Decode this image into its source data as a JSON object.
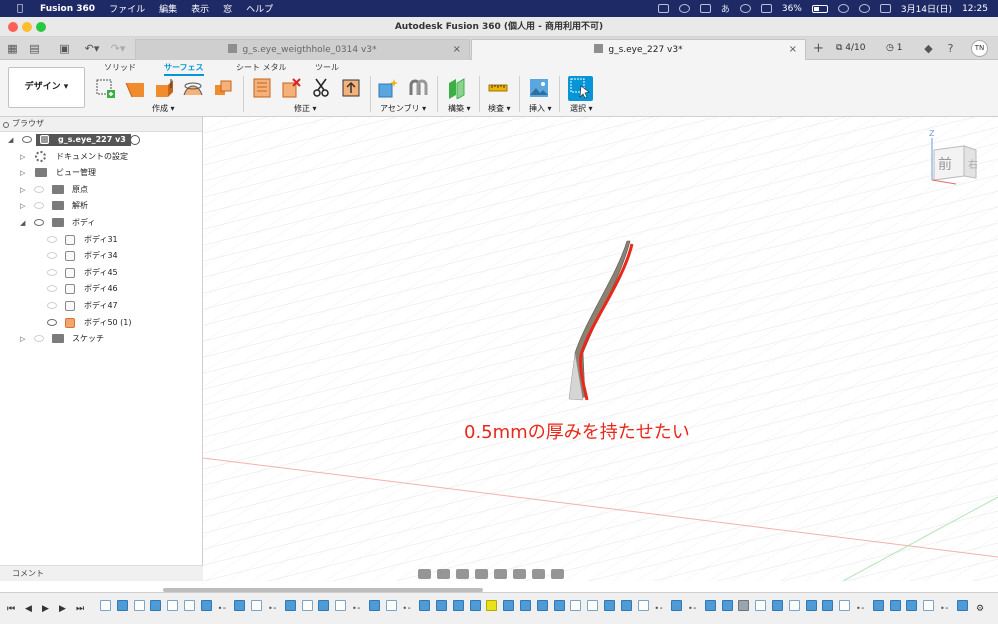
{
  "menubar": {
    "apple": "",
    "app": "Fusion 360",
    "items": [
      "ファイル",
      "編集",
      "表示",
      "窓",
      "ヘルプ"
    ],
    "battery": "36%",
    "date": "3月14日(日)",
    "time": "12:25",
    "input_mode": "あ"
  },
  "window": {
    "title": "Autodesk Fusion 360 (個人用 - 商用利用不可)"
  },
  "tabs": [
    {
      "label": "g_s.eye_weigthhole_0314 v3*"
    },
    {
      "label": "g_s.eye_227 v3*"
    }
  ],
  "tabbar": {
    "jobs": "4/10",
    "notifications": "1",
    "user_initials": "TN",
    "close_glyph": "×",
    "add_glyph": "+"
  },
  "toolbar": {
    "workspace_button": "デザイン ▾",
    "workspace_tabs": [
      "ソリッド",
      "サーフェス",
      "シート メタル",
      "ツール"
    ],
    "groups": [
      "作成 ▾",
      "修正 ▾",
      "アセンブリ ▾",
      "構築 ▾",
      "検査 ▾",
      "挿入 ▾",
      "選択 ▾"
    ],
    "tool_icons": [
      "create-sketch-icon",
      "extrude-icon",
      "patch-icon",
      "loft-icon",
      "thicken-icon",
      "trim-icon",
      "delete-icon",
      "split-icon",
      "stitch-icon",
      "component-icon",
      "joint-icon",
      "plane-icon",
      "measure-icon",
      "canvas-icon",
      "select-icon"
    ]
  },
  "browser": {
    "header": "ブラウザ",
    "root": "g_s.eye_227 v3",
    "items": [
      {
        "label": "ドキュメントの設定",
        "indent": 1
      },
      {
        "label": "ビュー管理",
        "indent": 1
      },
      {
        "label": "原点",
        "indent": 1
      },
      {
        "label": "解析",
        "indent": 1
      },
      {
        "label": "ボディ",
        "indent": 1
      },
      {
        "label": "ボディ31",
        "indent": 2
      },
      {
        "label": "ボディ34",
        "indent": 2
      },
      {
        "label": "ボディ45",
        "indent": 2
      },
      {
        "label": "ボディ46",
        "indent": 2
      },
      {
        "label": "ボディ47",
        "indent": 2
      },
      {
        "label": "ボディ50 (1)",
        "indent": 2
      },
      {
        "label": "スケッチ",
        "indent": 1
      }
    ],
    "comments": "コメント"
  },
  "viewport": {
    "annotation": "0.5mmの厚みを持たせたい",
    "annotation_color": "#e8281a",
    "viewcube_face": "前",
    "viewcube_side": "右",
    "axis_z": "Z"
  },
  "colors": {
    "accent": "#0696d7",
    "annotation": "#e8281a",
    "menubar": "#1e2a66"
  }
}
